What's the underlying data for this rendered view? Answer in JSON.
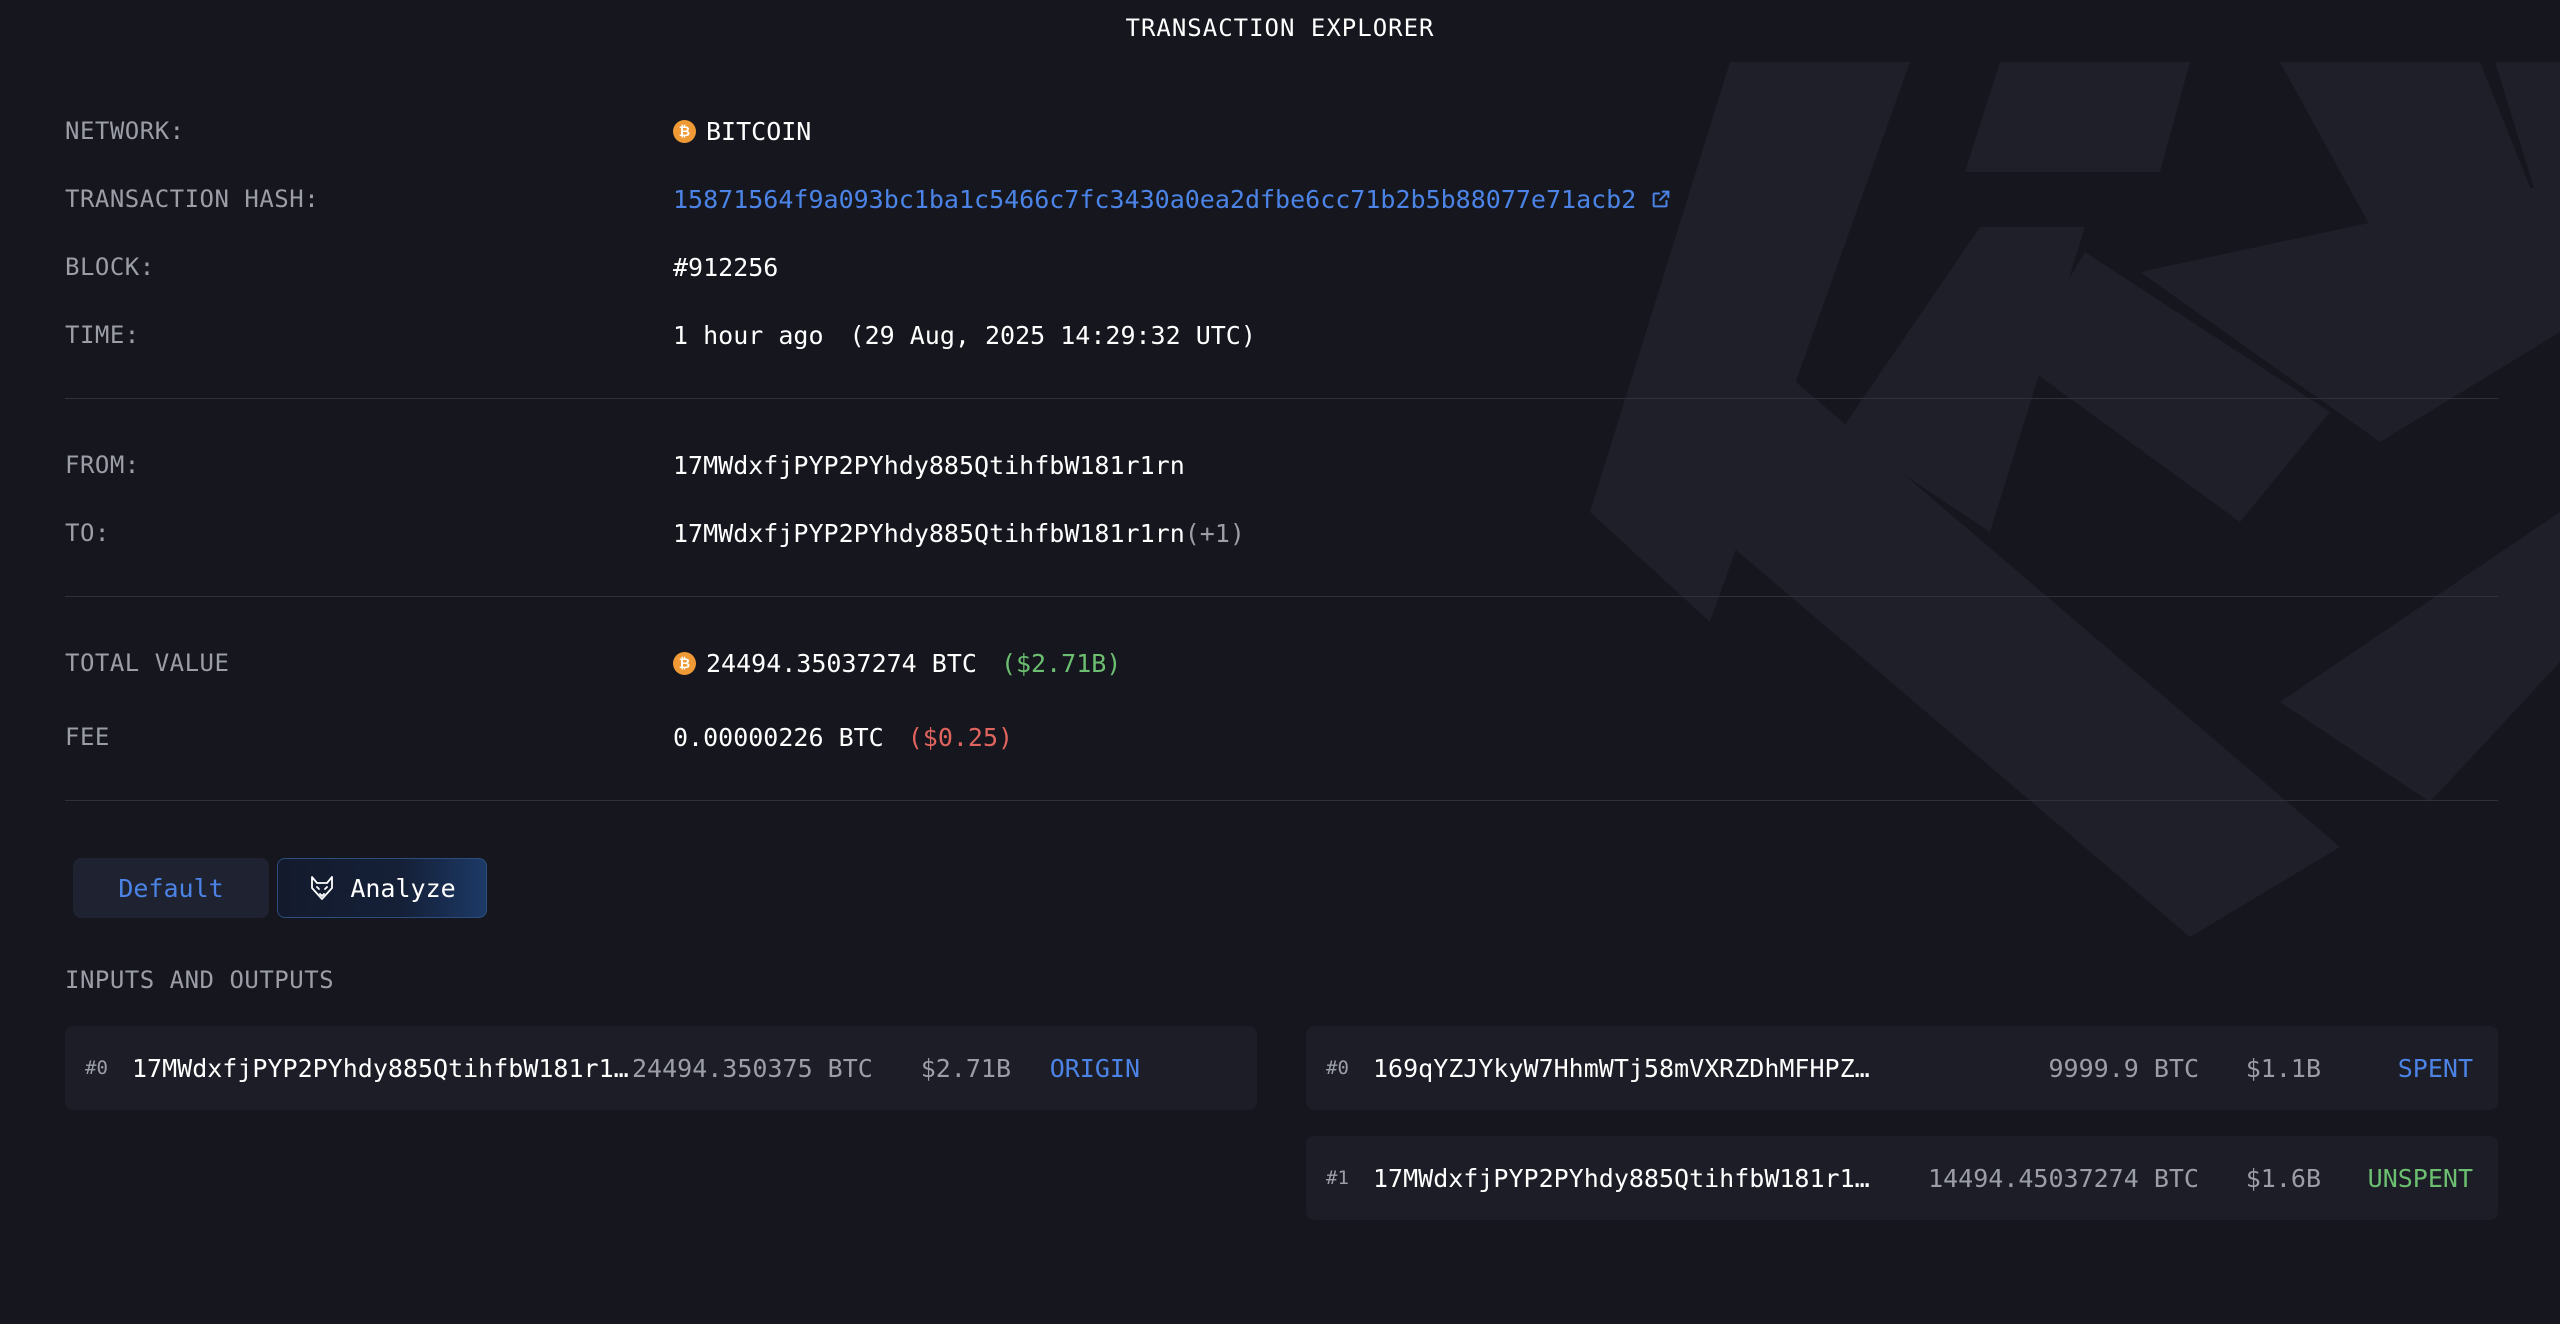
{
  "page_title": "TRANSACTION EXPLORER",
  "details": {
    "network": {
      "label": "NETWORK:",
      "value": "BITCOIN",
      "icon": "bitcoin-icon"
    },
    "hash": {
      "label": "TRANSACTION HASH:",
      "value": "15871564f9a093bc1ba1c5466c7fc3430a0ea2dfbe6cc71b2b5b88077e71acb2",
      "icon": "external-link-icon"
    },
    "block": {
      "label": "BLOCK:",
      "value": "#912256"
    },
    "time": {
      "label": "TIME:",
      "relative": "1 hour ago",
      "absolute": "(29 Aug, 2025 14:29:32 UTC)"
    },
    "from": {
      "label": "FROM:",
      "value": "17MWdxfjPYP2PYhdy885QtihfbW181r1rn"
    },
    "to": {
      "label": "TO:",
      "value": "17MWdxfjPYP2PYhdy885QtihfbW181r1rn",
      "extra": "(+1)"
    },
    "total_value": {
      "label": "TOTAL VALUE",
      "btc": "24494.35037274 BTC",
      "usd": "($2.71B)"
    },
    "fee": {
      "label": "FEE",
      "btc": "0.00000226 BTC",
      "usd": "($0.25)"
    }
  },
  "tabs": [
    {
      "label": "Default",
      "active": true
    },
    {
      "label": "Analyze",
      "icon": "fox-icon"
    }
  ],
  "io_title": "INPUTS AND OUTPUTS",
  "inputs": [
    {
      "index": "#0",
      "address": "17MWdxfjPYP2PYhdy885QtihfbW181r1rn",
      "btc": "24494.350375 BTC",
      "usd": "$2.71B",
      "status": "ORIGIN"
    }
  ],
  "outputs": [
    {
      "index": "#0",
      "address": "169qYZJYkyW7HhmWTj58mVXRZDhMFHPZ…",
      "btc": "9999.9 BTC",
      "usd": "$1.1B",
      "status": "SPENT"
    },
    {
      "index": "#1",
      "address": "17MWdxfjPYP2PYhdy885QtihfbW181r1…",
      "btc": "14494.45037274 BTC",
      "usd": "$1.6B",
      "status": "UNSPENT"
    }
  ],
  "colors": {
    "background": "#15161e",
    "accent_blue": "#4b84e6",
    "positive_green": "#6cbf70",
    "negative_red": "#e0645e",
    "bitcoin_orange": "#f09a35"
  }
}
